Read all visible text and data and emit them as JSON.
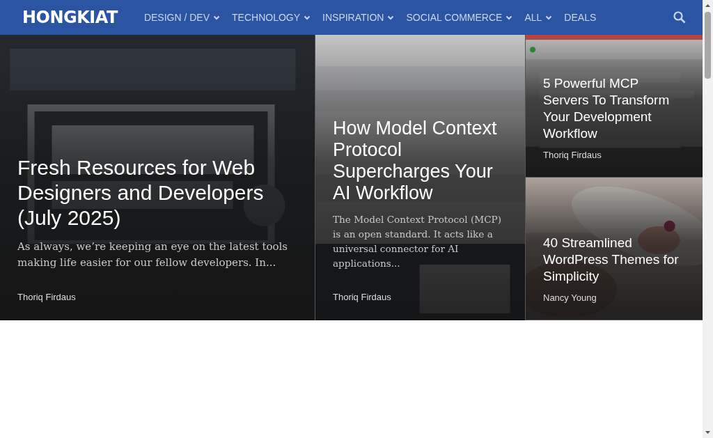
{
  "navbar": {
    "logo": "HONGKIAT",
    "items": [
      {
        "label": "DESIGN / DEV",
        "dropdown": true
      },
      {
        "label": "TECHNOLOGY",
        "dropdown": true
      },
      {
        "label": "INSPIRATION",
        "dropdown": true
      },
      {
        "label": "SOCIAL COMMERCE",
        "dropdown": true
      },
      {
        "label": "ALL",
        "dropdown": true
      },
      {
        "label": "DEALS",
        "dropdown": false
      }
    ]
  },
  "posts": [
    {
      "kind": "large",
      "title": "Fresh Resources for Web Designers and Developers (July 2025)",
      "excerpt": "As always, we’re keeping an eye on the latest tools making life easier for our fellow developers. In...",
      "author": "Thoriq Firdaus"
    },
    {
      "kind": "medium",
      "title": "How Model Context Protocol Supercharges Your AI Workflow",
      "excerpt": "The Model Context Protocol (MCP) is an open standard. It acts like a universal connector for AI applications...",
      "author": "Thoriq Firdaus"
    },
    {
      "kind": "small",
      "title": "5 Powerful MCP Servers To Transform Your Development Workflow",
      "author": "Thoriq Firdaus"
    },
    {
      "kind": "small",
      "title": "40 Streamlined WordPress Themes for Simplicity",
      "author": "Nancy Young"
    }
  ]
}
